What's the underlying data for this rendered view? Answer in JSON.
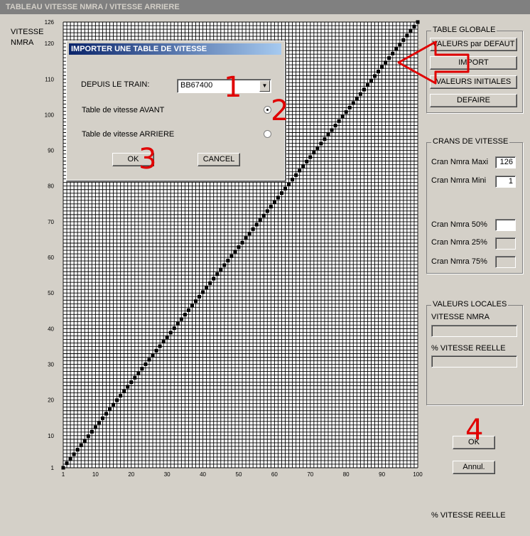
{
  "window": {
    "title": "TABLEAU VITESSE NMRA / VITESSE ARRIERE"
  },
  "chart_data": {
    "type": "scatter",
    "ylabel": "VITESSE\nNMRA",
    "xlabel": "% VITESSE REELLE",
    "xlim": [
      1,
      100
    ],
    "ylim": [
      1,
      126
    ],
    "xticks": [
      1,
      10,
      20,
      30,
      40,
      50,
      60,
      70,
      80,
      90,
      100
    ],
    "yticks": [
      1,
      10,
      20,
      30,
      40,
      50,
      60,
      70,
      80,
      90,
      100,
      110,
      120,
      126
    ],
    "grid": true,
    "series": [
      {
        "points_x_start": 1,
        "points_x_end": 100,
        "points_y_start": 1,
        "points_y_end": 126,
        "count": 100
      }
    ],
    "grid_color": "#000000",
    "background": "#ffffff",
    "point_color": "#000000"
  },
  "table_globale": {
    "title": "TABLE GLOBALE",
    "buttons": [
      "VALEURS par DEFAUT",
      "IMPORT",
      "VALEURS INITIALES",
      "DEFAIRE"
    ]
  },
  "crans": {
    "title": "CRANS DE VITESSE",
    "maxi_label": "Cran Nmra Maxi",
    "maxi_value": "126",
    "mini_label": "Cran Nmra Mini",
    "mini_value": "1",
    "p50_label": "Cran Nmra 50%",
    "p50_value": "",
    "p25_label": "Cran Nmra 25%",
    "p25_value": "",
    "p75_label": "Cran Nmra 75%",
    "p75_value": ""
  },
  "locales": {
    "title": "VALEURS LOCALES",
    "nmra_label": "VITESSE NMRA",
    "nmra_value": "",
    "reelle_label": "% VITESSE REELLE",
    "reelle_value": ""
  },
  "main_buttons": {
    "ok": "OK",
    "cancel": "Annul."
  },
  "dialog": {
    "title": "IMPORTER UNE TABLE DE VITESSE",
    "train_label": "DEPUIS LE TRAIN:",
    "train_value": "BB67400",
    "avant_label": "Table de vitesse AVANT",
    "avant_selected": true,
    "arriere_label": "Table de vitesse ARRIERE",
    "arriere_selected": false,
    "ok": "OK",
    "cancel": "CANCEL"
  },
  "annotations": [
    "1",
    "2",
    "3",
    "4"
  ],
  "annotation_color": "#e00000"
}
